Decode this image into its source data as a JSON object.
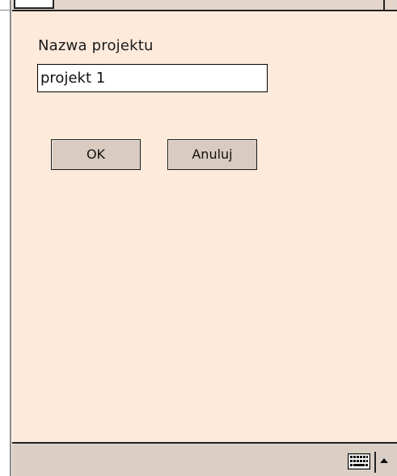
{
  "dialog": {
    "field_label": "Nazwa projektu",
    "field_value": "projekt 1",
    "ok_label": "OK",
    "cancel_label": "Anuluj"
  },
  "menu_bar": {
    "keyboard_icon": "keyboard-icon",
    "arrow_icon": "up-arrow-icon"
  },
  "colors": {
    "panel_background": "#fdeadb",
    "button_face": "#d9cbc0",
    "menu_bar": "#dbcfc5"
  }
}
